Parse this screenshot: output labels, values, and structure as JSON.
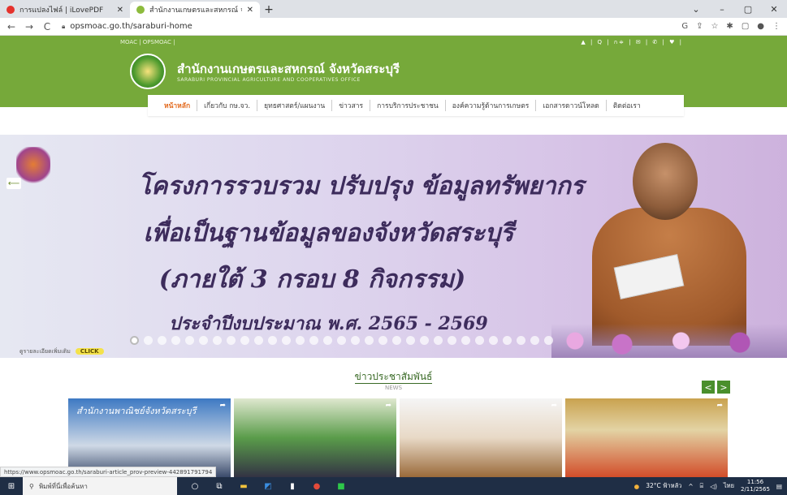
{
  "browser": {
    "tabs": [
      {
        "title": "การแปลงไฟล์ | iLovePDF",
        "favicon_color": "#e5322d",
        "active": false
      },
      {
        "title": "สำนักงานเกษตรและสหกรณ์ จังหวัดสระบุรี",
        "favicon_color": "#8dbb3d",
        "active": true
      }
    ],
    "new_tab_icon": "plus-icon",
    "url": "opsmoac.go.th/saraburi-home",
    "window_controls": [
      "⌄",
      "–",
      "▢",
      "✕"
    ],
    "ext_icons": [
      "G",
      "⇪",
      "☆",
      "✱",
      "▢",
      "●",
      "⋮"
    ]
  },
  "site": {
    "topstrip_left": "MOAC | OPSMOAC |",
    "topstrip_right": "▲ | Q | ก≑ | ✉ | ✆ | ♥ |",
    "name": "สำนักงานเกษตรและสหกรณ์ จังหวัดสระบุรี",
    "subtitle": "SARABURI PROVINCIAL AGRICULTURE AND COOPERATIVES OFFICE",
    "menu": [
      "หน้าหลัก",
      "เกี่ยวกับ กษ.จว.",
      "ยุทธศาสตร์/แผนงาน",
      "ข่าวสาร",
      "การบริการประชาชน",
      "องค์ความรู้ด้านการเกษตร",
      "เอกสารดาวน์โหลด",
      "ติดต่อเรา"
    ]
  },
  "banner": {
    "line1": "โครงการรวบรวม ปรับปรุง ข้อมูลทรัพยากร",
    "line2": "เพื่อเป็นฐานข้อมูลของจังหวัดสระบุรี",
    "line3": "(ภายใต้ 3 กรอบ 8 กิจกรรม)",
    "line4": "ประจำปีงบประมาณ พ.ศ. 2565 - 2569",
    "prev_icon": "arrow-left-icon",
    "slides_total": 31,
    "click_label": "CLICK",
    "click_prefix": "ดูรายละเอียดเพิ่มเติม"
  },
  "news": {
    "title": "ข่าวประชาสัมพันธ์",
    "subtitle": "NEWS",
    "prev": "<",
    "next": ">",
    "card1_sign": "สำนักงานพาณิชย์จังหวัดสระบุรี"
  },
  "status_url": "https://www.opsmoac.go.th/saraburi-article_prov-preview-442891791794",
  "taskbar": {
    "search_placeholder": "พิมพ์ที่นี่เพื่อค้นหา",
    "weather": "32°C ฟ้าหลัว",
    "lang": "ไทย",
    "time": "11:56",
    "date": "2/11/2565"
  }
}
